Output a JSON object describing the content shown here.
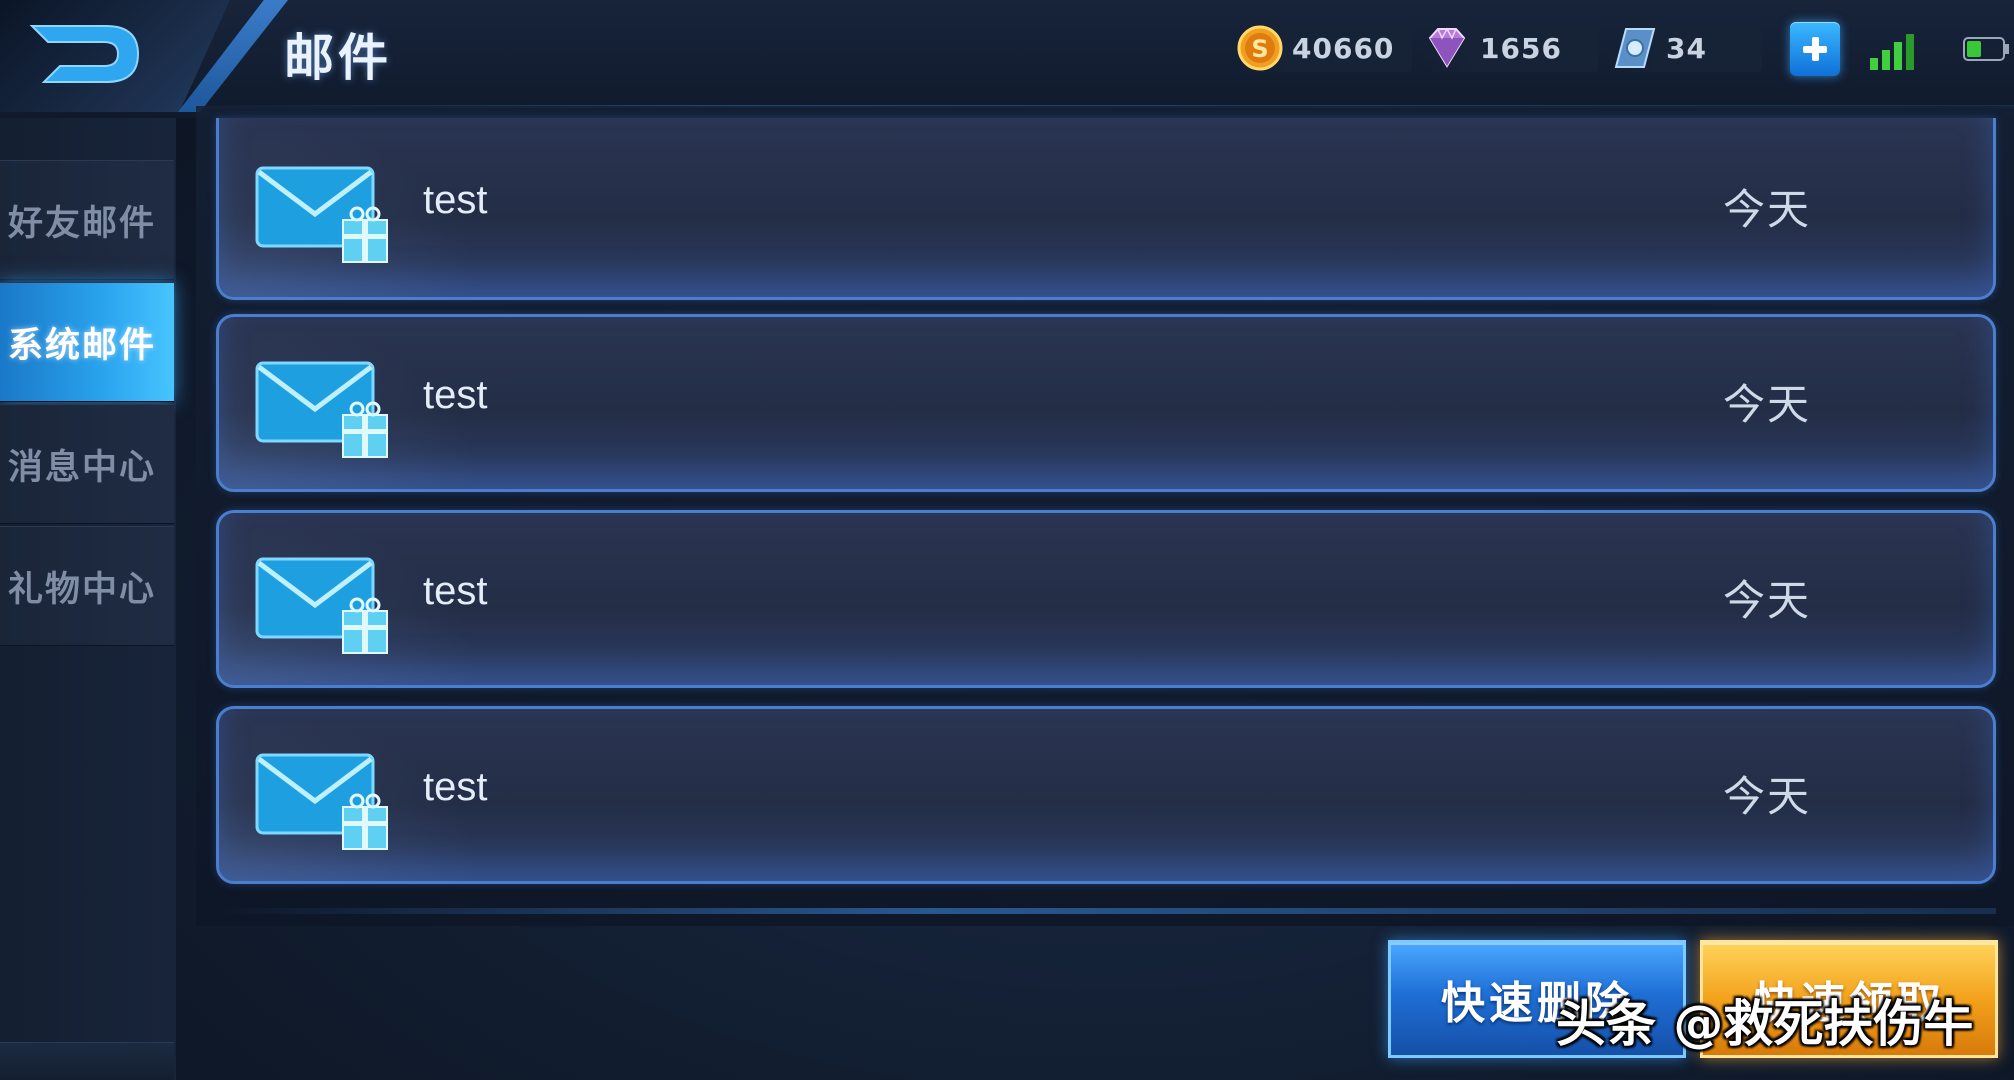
{
  "header": {
    "title": "邮件",
    "back_icon": "back-arrow-icon"
  },
  "currencies": {
    "gold": {
      "icon": "gold-coin-icon",
      "value": "40660"
    },
    "diamond": {
      "icon": "diamond-icon",
      "value": "1656"
    },
    "ticket": {
      "icon": "coupon-icon",
      "value": "34"
    }
  },
  "status": {
    "signal_icon": "signal-icon",
    "battery_icon": "battery-icon"
  },
  "sidebar": {
    "items": [
      {
        "label": "好友邮件",
        "active": false
      },
      {
        "label": "系统邮件",
        "active": true
      },
      {
        "label": "消息中心",
        "active": false
      },
      {
        "label": "礼物中心",
        "active": false
      }
    ]
  },
  "mails": [
    {
      "title": "test",
      "date": "今天",
      "icon": "mail-gift-icon"
    },
    {
      "title": "test",
      "date": "今天",
      "icon": "mail-gift-icon"
    },
    {
      "title": "test",
      "date": "今天",
      "icon": "mail-gift-icon"
    },
    {
      "title": "test",
      "date": "今天",
      "icon": "mail-gift-icon"
    }
  ],
  "actions": {
    "quick_delete": "快速删除",
    "quick_claim": "快速领取"
  },
  "watermark": "头条 @救死扶伤牛",
  "colors": {
    "accent_blue": "#2aa4ee",
    "claim_orange": "#f3a21c",
    "panel_border": "#4a7fd0"
  }
}
